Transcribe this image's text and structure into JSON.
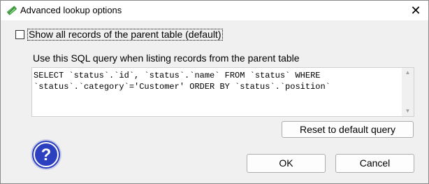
{
  "window": {
    "title": "Advanced lookup options",
    "close_glyph": "✕"
  },
  "checkbox": {
    "label": "Show all records of the parent table (default)",
    "checked": false
  },
  "query": {
    "label": "Use this SQL query when listing records from the parent table",
    "value": "SELECT `status`.`id`, `status`.`name` FROM `status` WHERE\n`status`.`category`='Customer' ORDER BY `status`.`position`",
    "scroll_up_glyph": "▲",
    "scroll_down_glyph": "▼"
  },
  "buttons": {
    "reset": "Reset to default query",
    "ok": "OK",
    "cancel": "Cancel"
  },
  "icons": {
    "title": "app-icon",
    "help": "help-icon",
    "help_glyph": "?",
    "help_color": "#2b3fbf"
  }
}
